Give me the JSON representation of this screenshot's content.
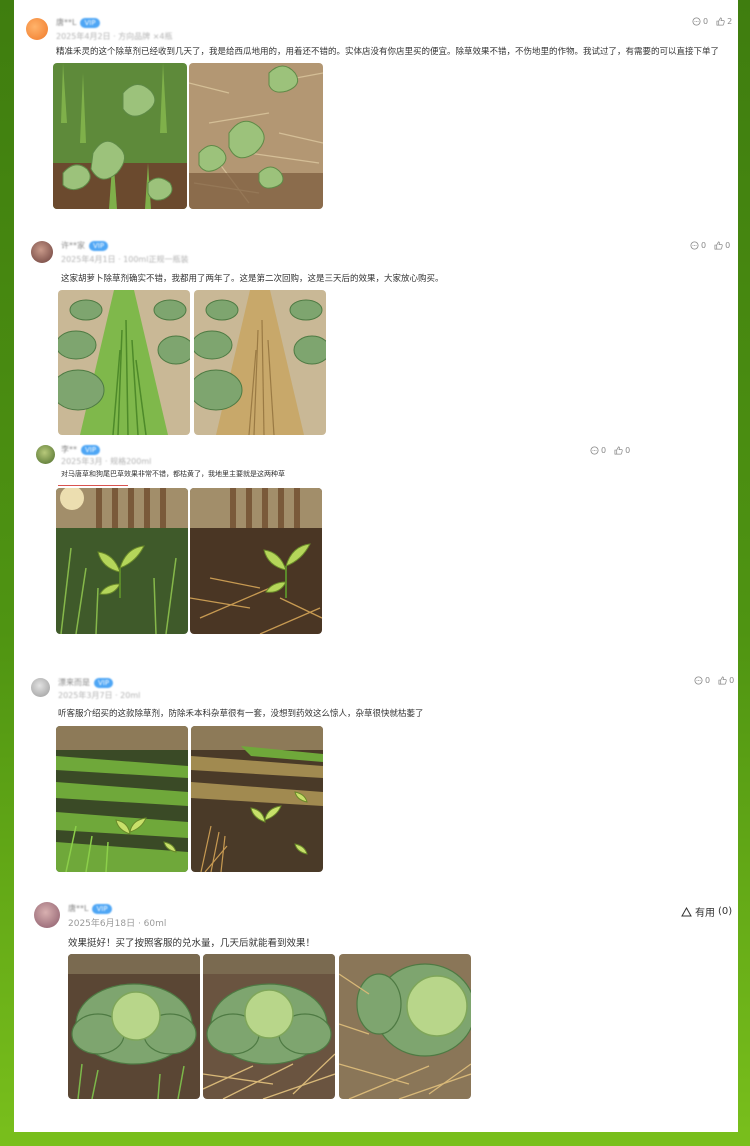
{
  "reviews": [
    {
      "user": "唐**L",
      "vip": "VIP",
      "meta": "2025年4月2日 · 方向品牌 ×4瓶",
      "text": "精准禾灵的这个除草剂已经收到几天了，我是给西瓜地用的，用着还不错的。实体店没有你店里买的便宜。除草效果不错，不伤地里的作物。我试过了，有需要的可以直接下单了",
      "comment_count": "0",
      "like_count": "2",
      "photos": [
        "watermelon-weedy-photo",
        "watermelon-weeded-photo"
      ]
    },
    {
      "user": "许**家",
      "vip": "VIP",
      "meta": "2025年4月1日 · 100ml正规一瓶装",
      "text": "这家胡萝卜除草剂确实不错，我都用了两年了。这是第二次回购，这是三天后的效果，大家放心购买。",
      "comment_count": "0",
      "like_count": "0",
      "photos": [
        "cabbage-row-before-photo",
        "cabbage-row-after-photo"
      ]
    },
    {
      "user": "李**",
      "vip": "VIP",
      "meta": "2025年3月 · 规格200ml",
      "text": "对马唐草和狗尾巴草效果非常不错，都枯黄了，我地里主要就是这两种草",
      "comment_count": "0",
      "like_count": "0",
      "photos": [
        "seedling-weedy-photo",
        "seedling-dried-weeds-photo"
      ]
    },
    {
      "user": "漂来而是",
      "vip": "VIP",
      "meta": "2025年3月7日 · 20ml",
      "text": "听客服介绍买的这款除草剂，防除禾本科杂草很有一套，没想到药效这么惊人，杂草很快就枯萎了",
      "comment_count": "0",
      "like_count": "0",
      "photos": [
        "field-rows-before-photo",
        "field-rows-after-photo"
      ]
    },
    {
      "user": "唐**L",
      "vip": "VIP",
      "meta": "2025年6月18日 · 60ml",
      "text": "效果挺好！买了按照客服的兑水量，几天后就能看到效果！",
      "useful_label": "有用",
      "useful_count": "(0)",
      "photos": [
        "cabbage-grass-photo",
        "cabbage-straw-photo",
        "cabbage-mulch-photo"
      ]
    }
  ]
}
